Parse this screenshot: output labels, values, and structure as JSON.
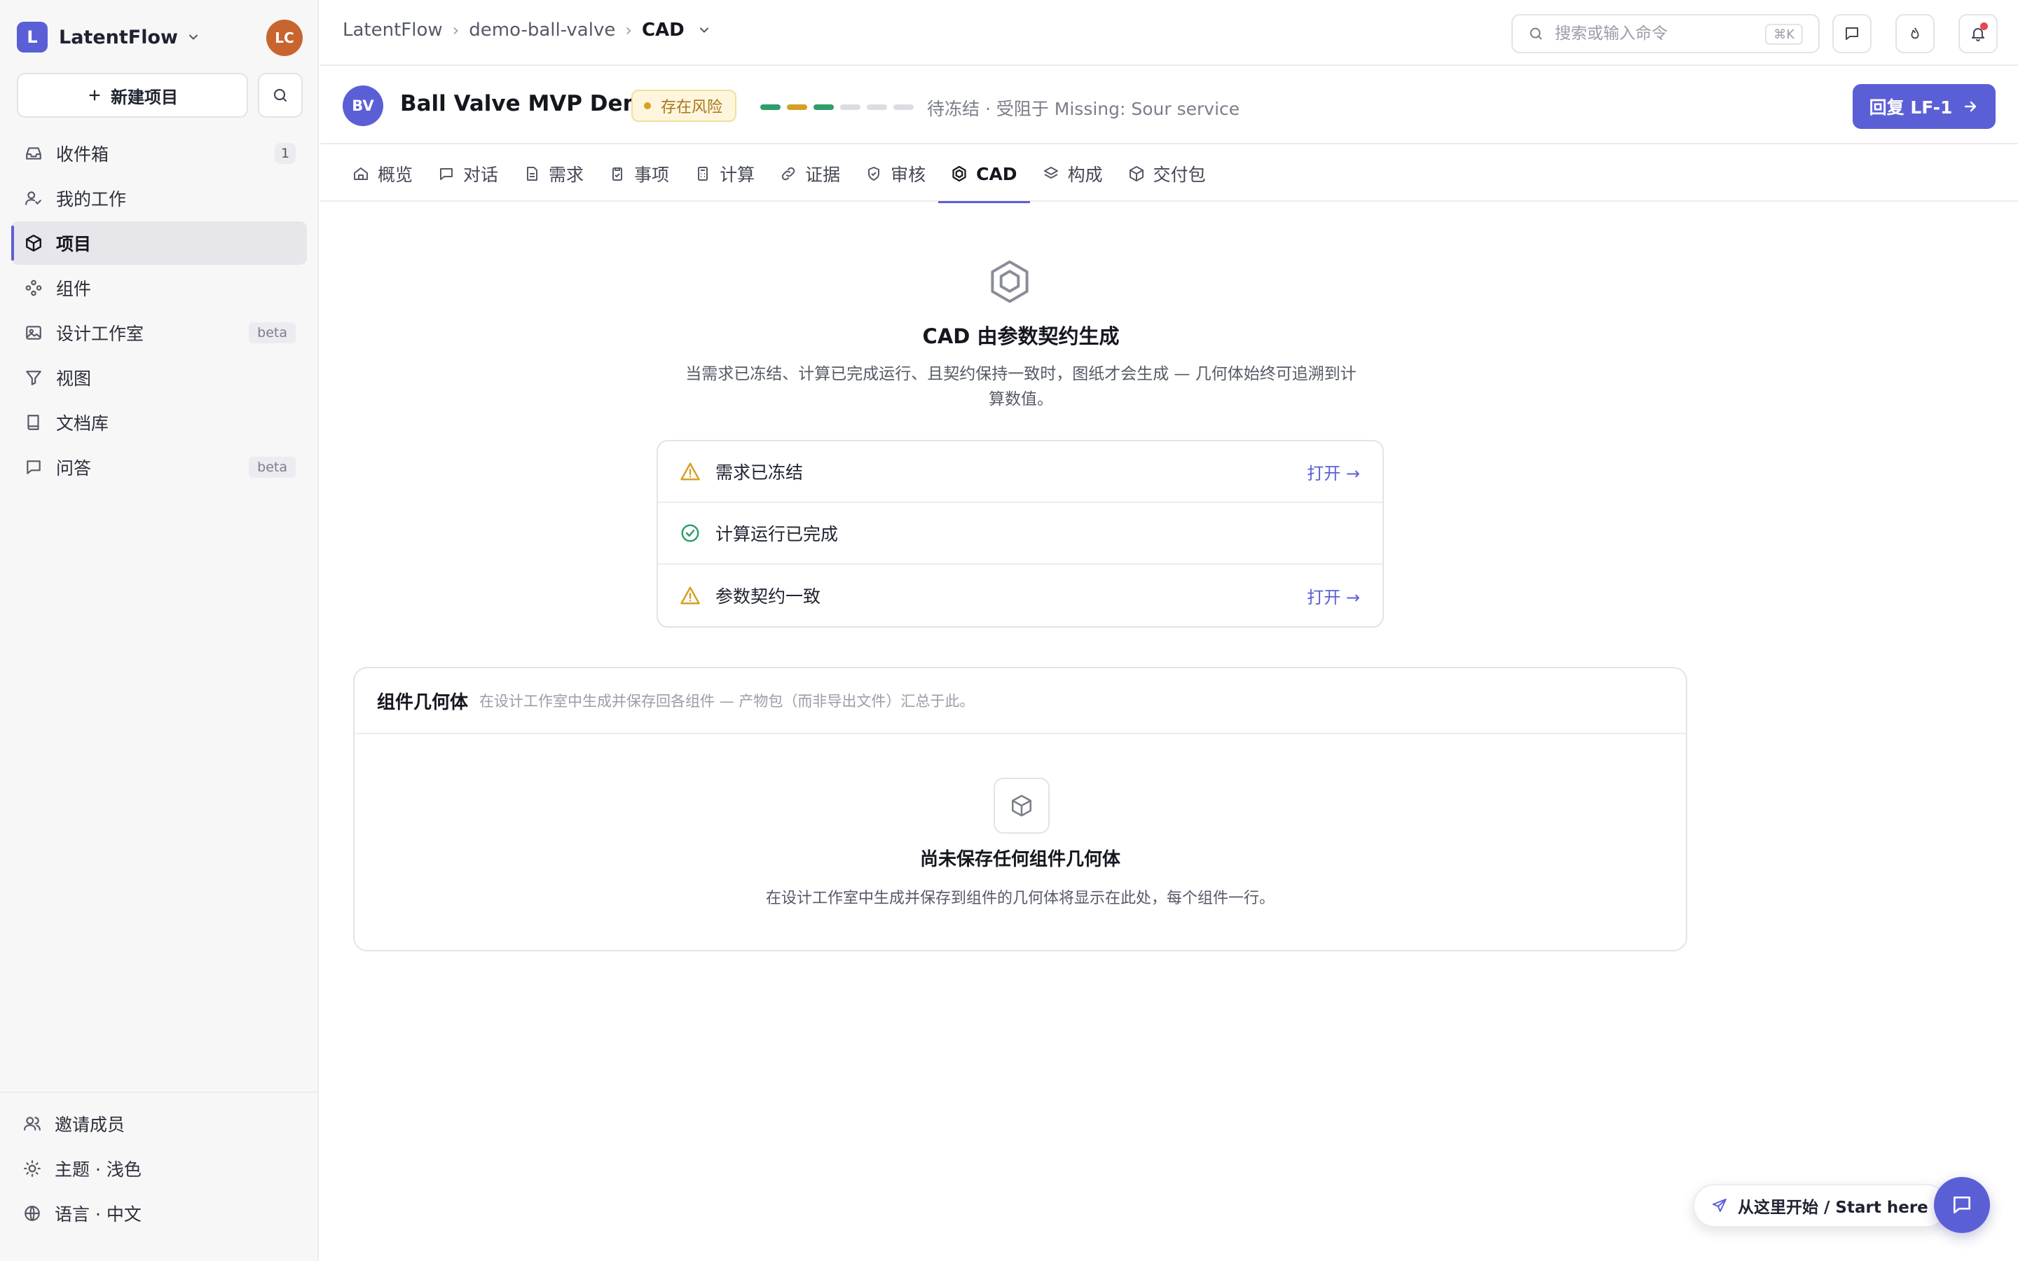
{
  "workspace": {
    "logo_letter": "L",
    "name": "LatentFlow",
    "user_initials": "LC"
  },
  "sidebar": {
    "new_project_label": "新建项目",
    "items": [
      {
        "label": "收件箱",
        "icon": "inbox-icon",
        "badge": "1"
      },
      {
        "label": "我的工作",
        "icon": "user-check-icon"
      },
      {
        "label": "项目",
        "icon": "box-icon",
        "active": true
      },
      {
        "label": "组件",
        "icon": "components-icon"
      },
      {
        "label": "设计工作室",
        "icon": "image-icon",
        "tag": "beta"
      },
      {
        "label": "视图",
        "icon": "filter-icon"
      },
      {
        "label": "文档库",
        "icon": "book-icon"
      },
      {
        "label": "问答",
        "icon": "message-icon",
        "tag": "beta"
      }
    ],
    "bottom": [
      {
        "label": "邀请成员",
        "icon": "users-icon"
      },
      {
        "label": "主题 · 浅色",
        "icon": "sun-icon"
      },
      {
        "label": "语言 · 中文",
        "icon": "globe-icon"
      }
    ]
  },
  "breadcrumb": {
    "root": "LatentFlow",
    "project": "demo-ball-valve",
    "current": "CAD"
  },
  "search": {
    "placeholder": "搜索或输入命令",
    "shortcut": "⌘K"
  },
  "project": {
    "initials": "BV",
    "title": "Ball Valve MVP Demo",
    "risk_label": "存在风险",
    "status": "待冻结 · 受阻于 Missing: Sour service",
    "reply_label": "回复 LF-1",
    "progress_segments": [
      {
        "state": "done",
        "color": "#2e9e6a"
      },
      {
        "state": "warn",
        "color": "#d6a024"
      },
      {
        "state": "done",
        "color": "#2e9e6a"
      },
      {
        "state": "pending",
        "color": "#dcdde2"
      },
      {
        "state": "pending",
        "color": "#dcdde2"
      },
      {
        "state": "pending",
        "color": "#dcdde2"
      }
    ]
  },
  "tabs": [
    {
      "label": "概览",
      "icon": "home-icon"
    },
    {
      "label": "对话",
      "icon": "chat-icon"
    },
    {
      "label": "需求",
      "icon": "file-text-icon"
    },
    {
      "label": "事项",
      "icon": "clipboard-check-icon"
    },
    {
      "label": "计算",
      "icon": "calculator-icon"
    },
    {
      "label": "证据",
      "icon": "link-icon"
    },
    {
      "label": "审核",
      "icon": "shield-check-icon"
    },
    {
      "label": "CAD",
      "icon": "hexagon-icon",
      "active": true
    },
    {
      "label": "构成",
      "icon": "layers-icon"
    },
    {
      "label": "交付包",
      "icon": "package-icon"
    }
  ],
  "cad": {
    "title": "CAD 由参数契约生成",
    "description": "当需求已冻结、计算已完成运行、且契约保持一致时，图纸才会生成 — 几何体始终可追溯到计算数值。",
    "prerequisites": [
      {
        "label": "需求已冻结",
        "status": "warning",
        "link": "打开 →"
      },
      {
        "label": "计算运行已完成",
        "status": "ok",
        "link": ""
      },
      {
        "label": "参数契约一致",
        "status": "warning",
        "link": "打开 →"
      }
    ]
  },
  "geometry": {
    "title": "组件几何体",
    "subtitle": "在设计工作室中生成并保存回各组件 — 产物包（而非导出文件）汇总于此。",
    "empty_title": "尚未保存任何组件几何体",
    "empty_desc": "在设计工作室中生成并保存到组件的几何体将显示在此处，每个组件一行。"
  },
  "floating": {
    "start_label": "从这里开始 / Start here"
  },
  "colors": {
    "accent": "#5b5fd6",
    "warning": "#d6a024",
    "success": "#2e9e6a"
  }
}
